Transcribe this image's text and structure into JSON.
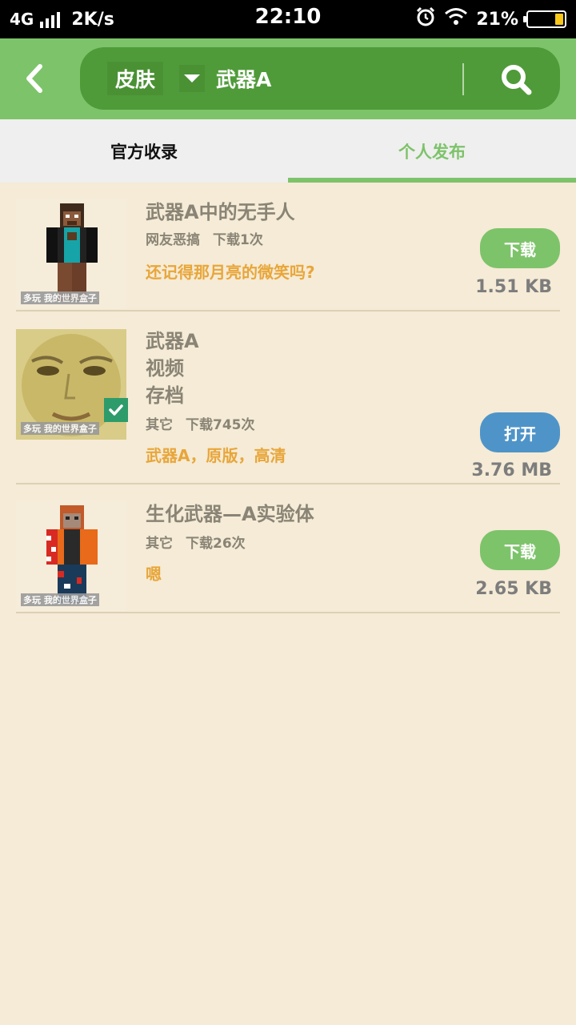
{
  "status_bar": {
    "network": "4G",
    "speed": "2K/s",
    "time": "22:10",
    "battery": "21%",
    "icons": [
      "signal-icon",
      "alarm-icon",
      "wifi-icon",
      "battery-icon"
    ]
  },
  "header": {
    "back_icon": "chevron-left-icon",
    "category": "皮肤",
    "query": "武器A",
    "search_icon": "search-icon"
  },
  "tabs": [
    {
      "label": "官方收录",
      "active": false
    },
    {
      "label": "个人发布",
      "active": true
    }
  ],
  "items": [
    {
      "title": "武器A中的无手人",
      "category": "网友恶搞",
      "downloads": "下载1次",
      "description": "还记得那月亮的微笑吗?",
      "button": "下载",
      "size": "1.51 KB",
      "watermark": "多玩 我的世界盒子"
    },
    {
      "title_lines": [
        "武器A",
        "视频",
        "存档"
      ],
      "category": "其它",
      "downloads": "下载745次",
      "description": "武器A，原版，高清",
      "button": "打开",
      "size": "3.76 MB",
      "watermark": "多玩 我的世界盒子"
    },
    {
      "title": "生化武器—A实验体",
      "category": "其它",
      "downloads": "下载26次",
      "description": "嗯",
      "button": "下载",
      "size": "2.65 KB",
      "watermark": "多玩 我的世界盒子"
    }
  ],
  "colors": {
    "accent_green": "#7dc36a",
    "dark_green": "#4f9b39",
    "open_blue": "#4f94c8",
    "desc_orange": "#e8a63a",
    "background": "#f5ebd6"
  }
}
